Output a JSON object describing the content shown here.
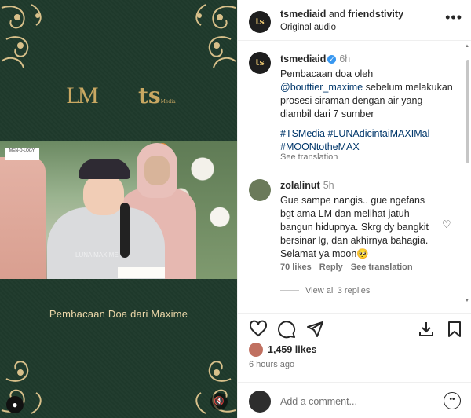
{
  "media": {
    "logo_left": "LM",
    "logo_right": "ts",
    "logo_right_sub": "Media",
    "badge": "MEN-O-LOGY",
    "watermark": "LUNA MAXIME",
    "caption": "Pembacaan Doa dari Maxime"
  },
  "header": {
    "user": "tsmediaid",
    "and_text": " and ",
    "collab": "friendstivity",
    "subtitle": "Original audio",
    "more_icon": "more-horizontal-icon"
  },
  "post": {
    "author": "tsmediaid",
    "time": "6h",
    "caption_line1": "Pembacaan doa oleh",
    "mention": "@bouttier_maxime",
    "caption_rest": " sebelum melakukan prosesi siraman dengan air yang diambil dari 7 sumber",
    "hashtags": "#TSMedia #LUNAdicintaiMAXIMal #MOONtotheMAX",
    "see_translation": "See translation"
  },
  "comment": {
    "author": "zolalinut",
    "time": "5h",
    "text": "Gue sampe nangis.. gue ngefans bgt ama LM dan melihat jatuh bangun hidupnya. Skrg dy bangkit bersinar lg, dan akhirnya bahagia. Selamat ya moon🥺",
    "likes": "70 likes",
    "reply": "Reply",
    "see_translation": "See translation",
    "view_replies": "View all 3 replies"
  },
  "stats": {
    "likes": "1,459 likes",
    "posted": "6 hours ago"
  },
  "composer": {
    "placeholder": "Add a comment..."
  },
  "colors": {
    "media_bg": "#1f3a2c",
    "gold": "#c9a862",
    "link": "#00376b",
    "verified": "#3897f0"
  }
}
